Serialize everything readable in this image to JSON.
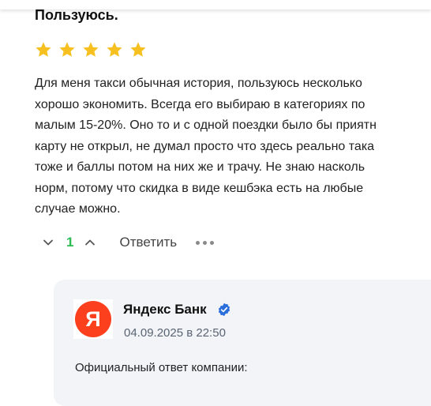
{
  "review": {
    "title": "Пользуюсь.",
    "rating": 5,
    "rating_max": 5,
    "star_color": "#f6c120",
    "text_lines": [
      "Для меня такси обычная история, пользуюсь несколько",
      "хорошо экономить. Всегда его выбираю в категориях по",
      "малым 15-20%. Оно то и с одной поездки было бы приятн",
      "карту не открыл, не думал просто что здесь реально така",
      "тоже и баллы потом на них же и трачу. Не знаю насколь",
      "норм, потому что скидка в виде кешбэка есть на любые",
      "случае можно."
    ]
  },
  "actions": {
    "downvote_icon": "chevron-down-icon",
    "vote_count": "1",
    "vote_count_color": "#2dbb54",
    "upvote_icon": "chevron-up-icon",
    "reply_label": "Ответить",
    "more_icon": "more-dots-icon"
  },
  "company_reply": {
    "logo_letter": "Я",
    "logo_color": "#fc3f1d",
    "name": "Яндекс Банк",
    "verified_icon": "verified-check-icon",
    "verified_color": "#2a6fdb",
    "date": "04.09.2025 в 22:50",
    "official_label": "Официальный ответ компании:"
  }
}
